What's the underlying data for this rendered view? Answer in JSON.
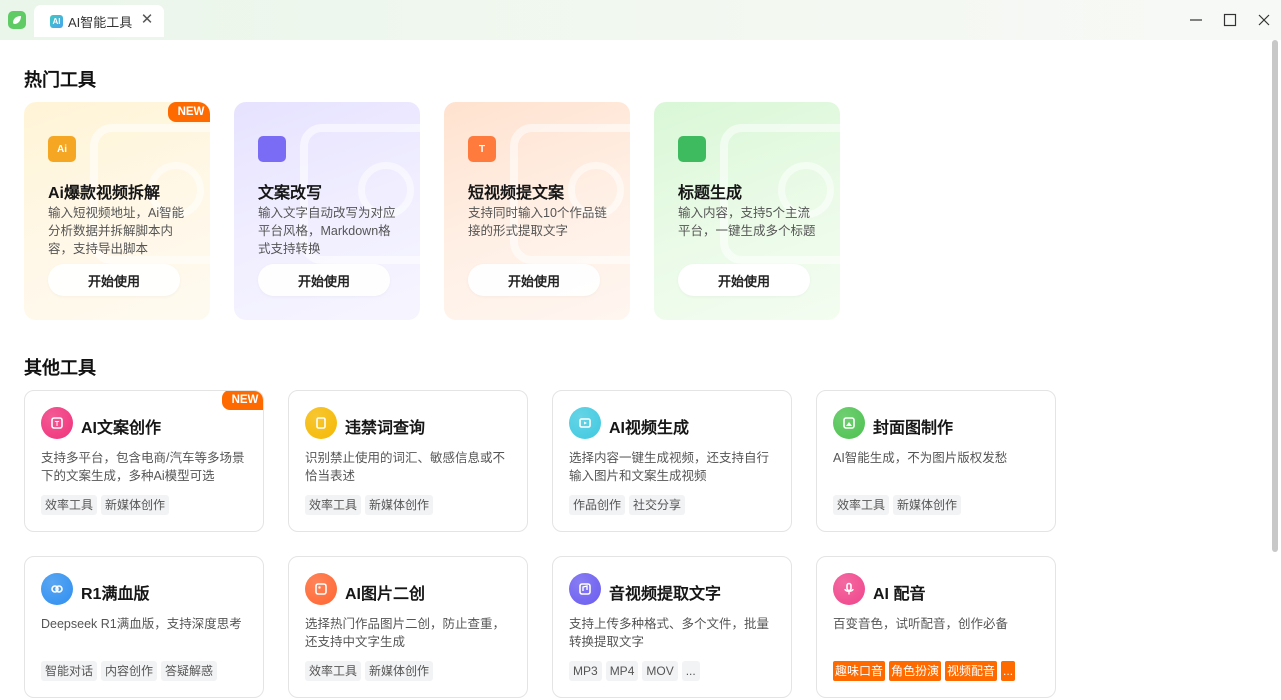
{
  "window": {
    "tab_title": "AI智能工具",
    "tab_icon_text": "AI",
    "close_glyph": "✕"
  },
  "hot_section": {
    "title": "热门工具",
    "cards": [
      {
        "name": "Ai爆款视频拆解",
        "desc": "输入短视频地址，Ai智能分析数据并拆解脚本内容，支持导出脚本",
        "button": "开始使用",
        "badge": "NEW",
        "icon": "ai-video-icon",
        "icon_text": "Ai",
        "color": "#f5a623"
      },
      {
        "name": "文案改写",
        "desc": "输入文字自动改写为对应平台风格，Markdown格式支持转换",
        "button": "开始使用",
        "badge": "",
        "icon": "rewrite-icon",
        "icon_text": "",
        "color": "#7b6cf6"
      },
      {
        "name": "短视频提文案",
        "desc": "支持同时输入10个作品链接的形式提取文字",
        "button": "开始使用",
        "badge": "",
        "icon": "text-extract-icon",
        "icon_text": "T",
        "color": "#ff7a3d"
      },
      {
        "name": "标题生成",
        "desc": "输入内容，支持5个主流平台，一键生成多个标题",
        "button": "开始使用",
        "badge": "",
        "icon": "title-gen-icon",
        "icon_text": "",
        "color": "#3dbb5e"
      }
    ]
  },
  "other_section": {
    "title": "其他工具",
    "cards": [
      {
        "name": "AI文案创作",
        "desc": "支持多平台，包含电商/汽车等多场景下的文案生成，多种Ai模型可选",
        "tags": [
          "效率工具",
          "新媒体创作"
        ],
        "badge": "NEW",
        "icon": "ai-copywriting-icon",
        "color": "#f0317a"
      },
      {
        "name": "违禁词查询",
        "desc": "识别禁止使用的词汇、敏感信息或不恰当表述",
        "tags": [
          "效率工具",
          "新媒体创作"
        ],
        "badge": "",
        "icon": "forbidden-words-icon",
        "color": "#f5b800"
      },
      {
        "name": "AI视频生成",
        "desc": "选择内容一键生成视频，还支持自行输入图片和文案生成视频",
        "tags": [
          "作品创作",
          "社交分享"
        ],
        "badge": "",
        "icon": "ai-video-gen-icon",
        "color": "#3fc9e0"
      },
      {
        "name": "封面图制作",
        "desc": "AI智能生成，不为图片版权发愁",
        "tags": [
          "效率工具",
          "新媒体创作"
        ],
        "badge": "",
        "icon": "cover-image-icon",
        "color": "#4cc24f"
      },
      {
        "name": "R1满血版",
        "desc": "Deepseek R1满血版，支持深度思考",
        "tags": [
          "智能对话",
          "内容创作",
          "答疑解惑"
        ],
        "badge": "",
        "icon": "deepseek-icon",
        "color": "#2f8ff0"
      },
      {
        "name": "AI图片二创",
        "desc": "选择热门作品图片二创，防止查重，还支持中文字生成",
        "tags": [
          "效率工具",
          "新媒体创作"
        ],
        "badge": "",
        "icon": "image-remix-icon",
        "color": "#ff6530"
      },
      {
        "name": "音视频提取文字",
        "desc": "支持上传多种格式、多个文件，批量转换提取文字",
        "tags": [
          "MP3",
          "MP4",
          "MOV",
          "..."
        ],
        "badge": "",
        "icon": "audio-extract-icon",
        "color": "#6a5cf0"
      },
      {
        "name": "AI 配音",
        "desc": "百变音色，试听配音，创作必备",
        "tags": [
          "趣味口音",
          "角色扮演",
          "视频配音",
          "..."
        ],
        "badge": "",
        "icon": "voiceover-icon",
        "color": "#f0448a"
      }
    ]
  }
}
